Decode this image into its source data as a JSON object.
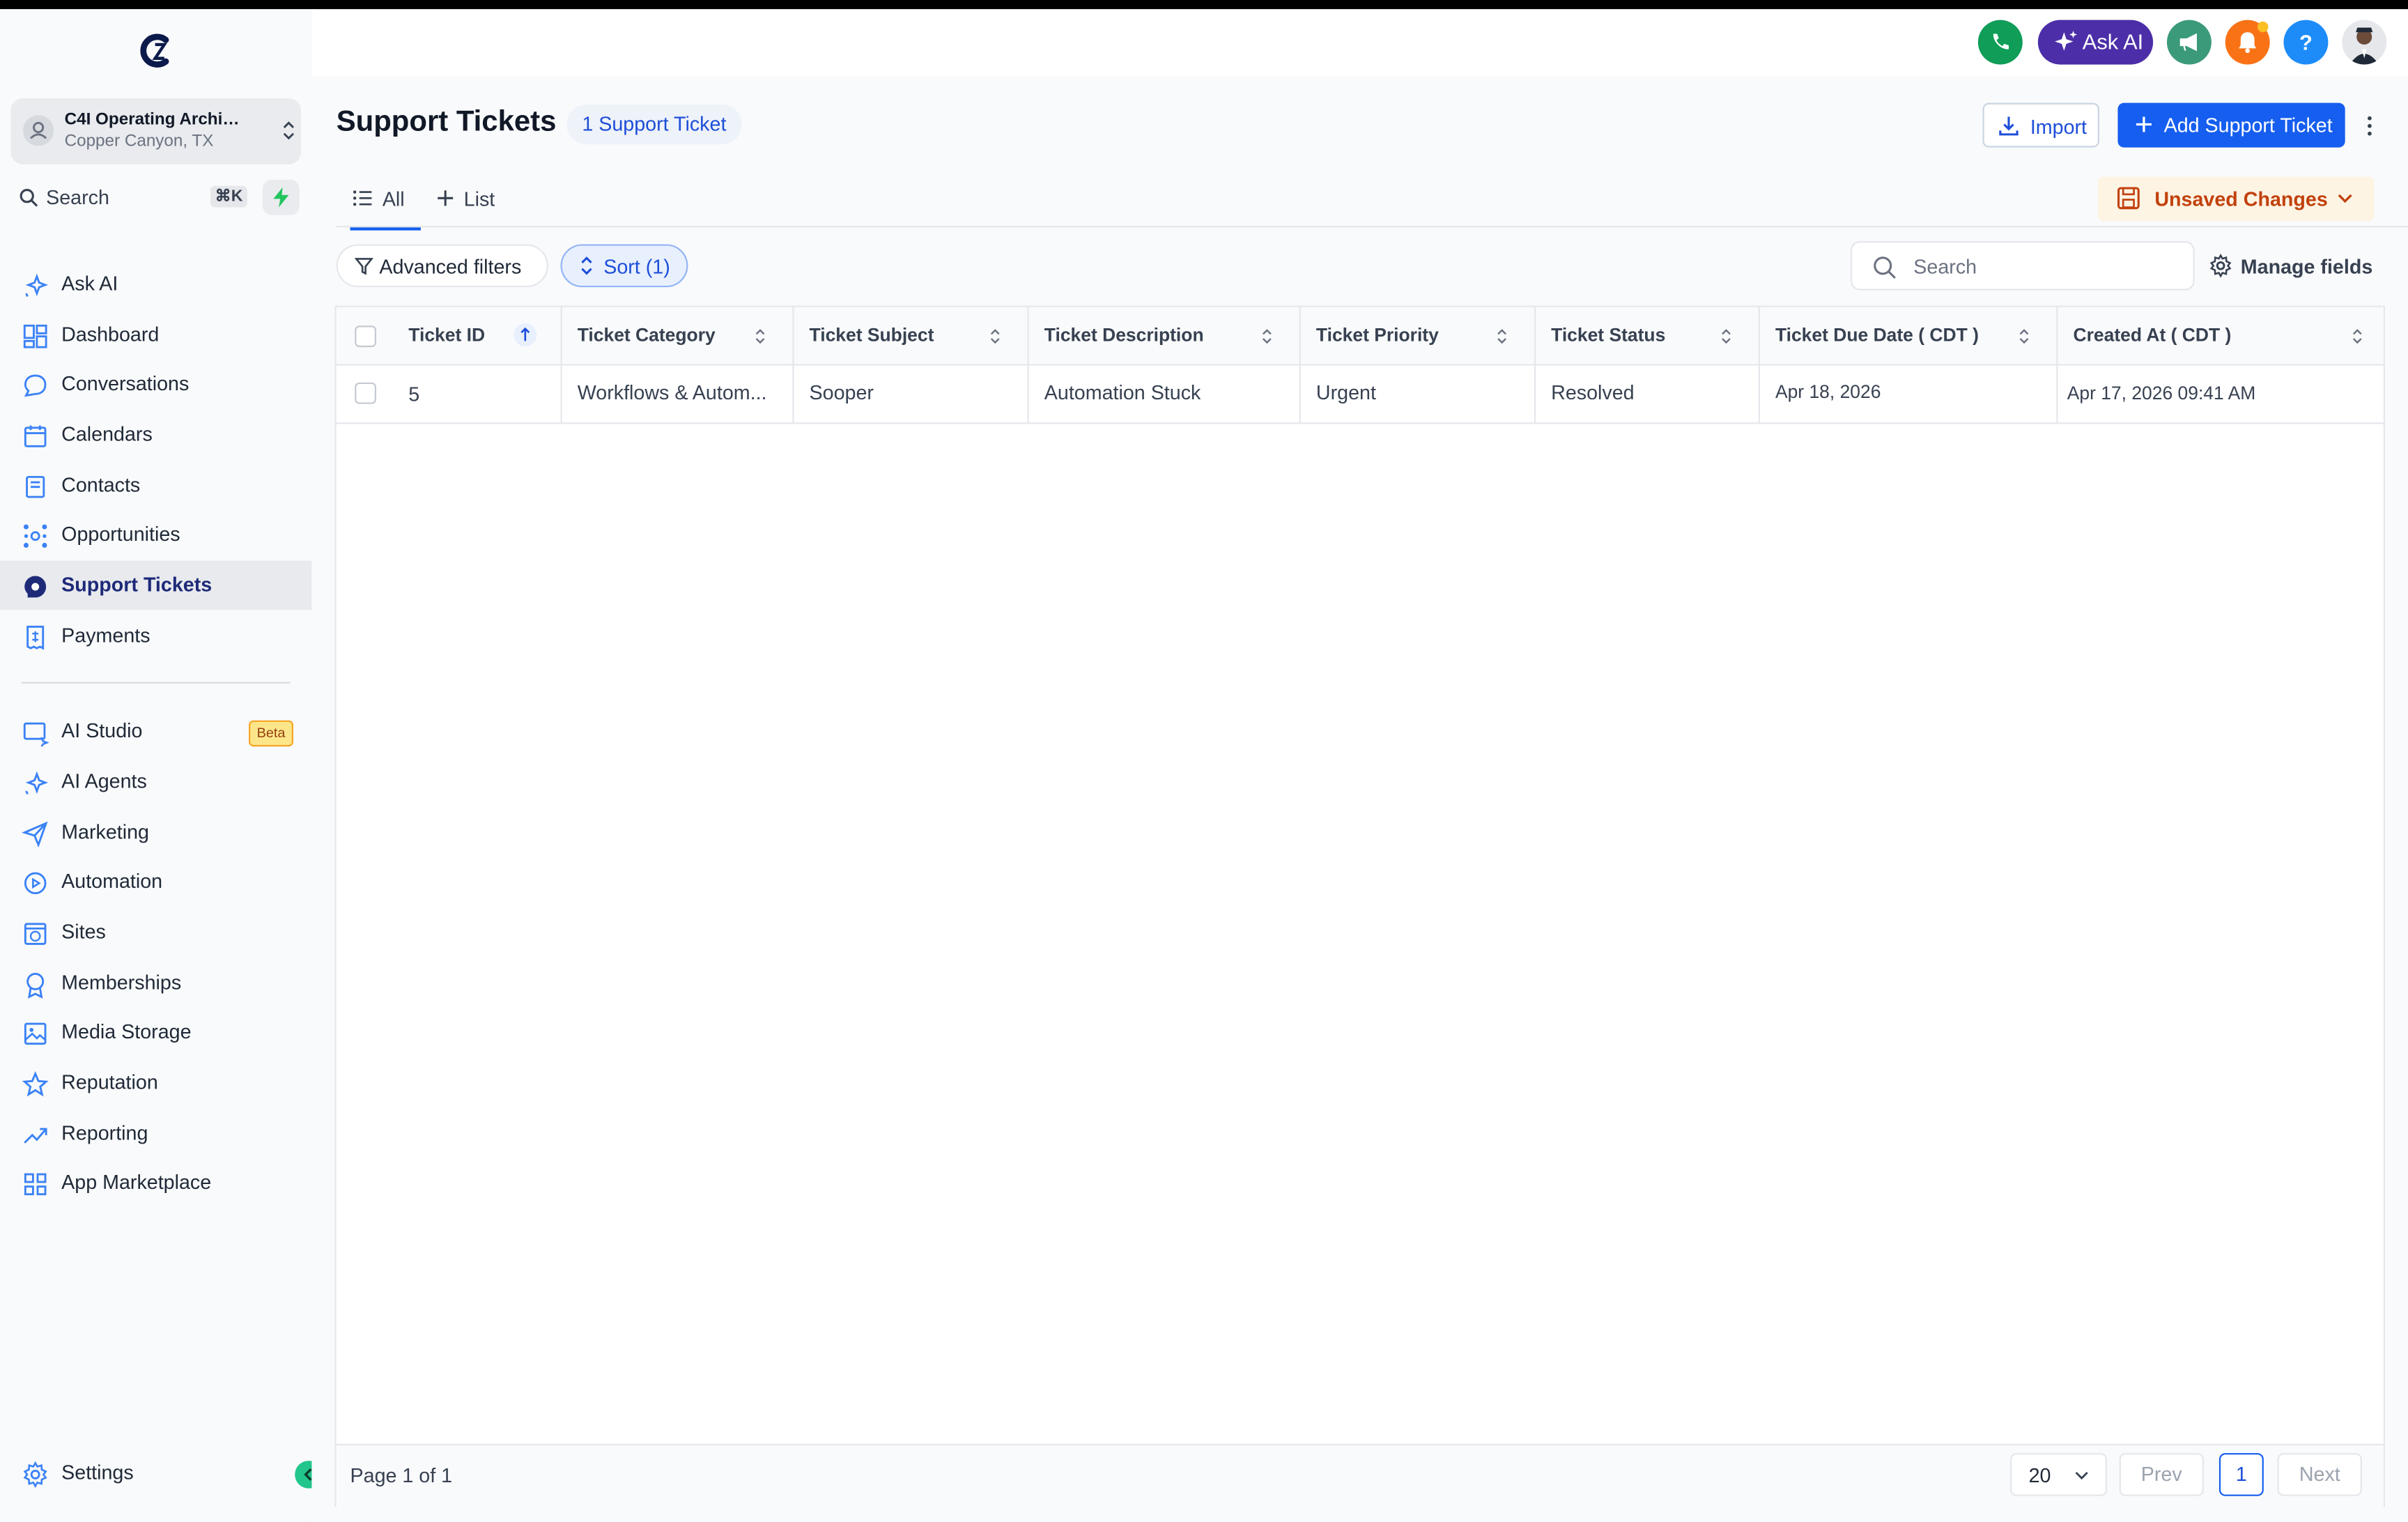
{
  "account": {
    "name": "C4I Operating Archit...",
    "location": "Copper Canyon, TX"
  },
  "sidebar_search": {
    "label": "Search",
    "shortcut": "⌘K"
  },
  "nav": {
    "primary": [
      "Ask AI",
      "Dashboard",
      "Conversations",
      "Calendars",
      "Contacts",
      "Opportunities",
      "Support Tickets",
      "Payments"
    ],
    "secondary": [
      "AI Studio",
      "AI Agents",
      "Marketing",
      "Automation",
      "Sites",
      "Memberships",
      "Media Storage",
      "Reputation",
      "Reporting",
      "App Marketplace"
    ],
    "beta": "Beta",
    "settings": "Settings",
    "active": "Support Tickets"
  },
  "header": {
    "ask_ai": "Ask AI"
  },
  "page": {
    "title": "Support Tickets",
    "count_badge": "1 Support Ticket",
    "import": "Import",
    "add": "Add Support Ticket",
    "tabs": [
      "All",
      "List"
    ],
    "unsaved": "Unsaved Changes",
    "advanced_filters": "Advanced filters",
    "sort": "Sort (1)",
    "search_placeholder": "Search",
    "manage_fields": "Manage fields"
  },
  "table": {
    "columns": [
      "Ticket ID",
      "Ticket Category",
      "Ticket Subject",
      "Ticket Description",
      "Ticket Priority",
      "Ticket Status",
      "Ticket Due Date ( CDT )",
      "Created At ( CDT )"
    ],
    "rows": [
      [
        "5",
        "Workflows & Autom...",
        "Sooper",
        "Automation Stuck",
        "Urgent",
        "Resolved",
        "Apr 18, 2026",
        "Apr 17, 2026 09:41 AM"
      ]
    ]
  },
  "pagination": {
    "page_info": "Page 1 of 1",
    "per_page": "20",
    "prev": "Prev",
    "current": "1",
    "next": "Next"
  },
  "colors": {
    "primary": "#155eef",
    "active_nav": "#1e2a78",
    "askai": "#4c2ea8",
    "phone": "#0f9d58",
    "bell": "#f97316",
    "help": "#1d8cf8"
  }
}
